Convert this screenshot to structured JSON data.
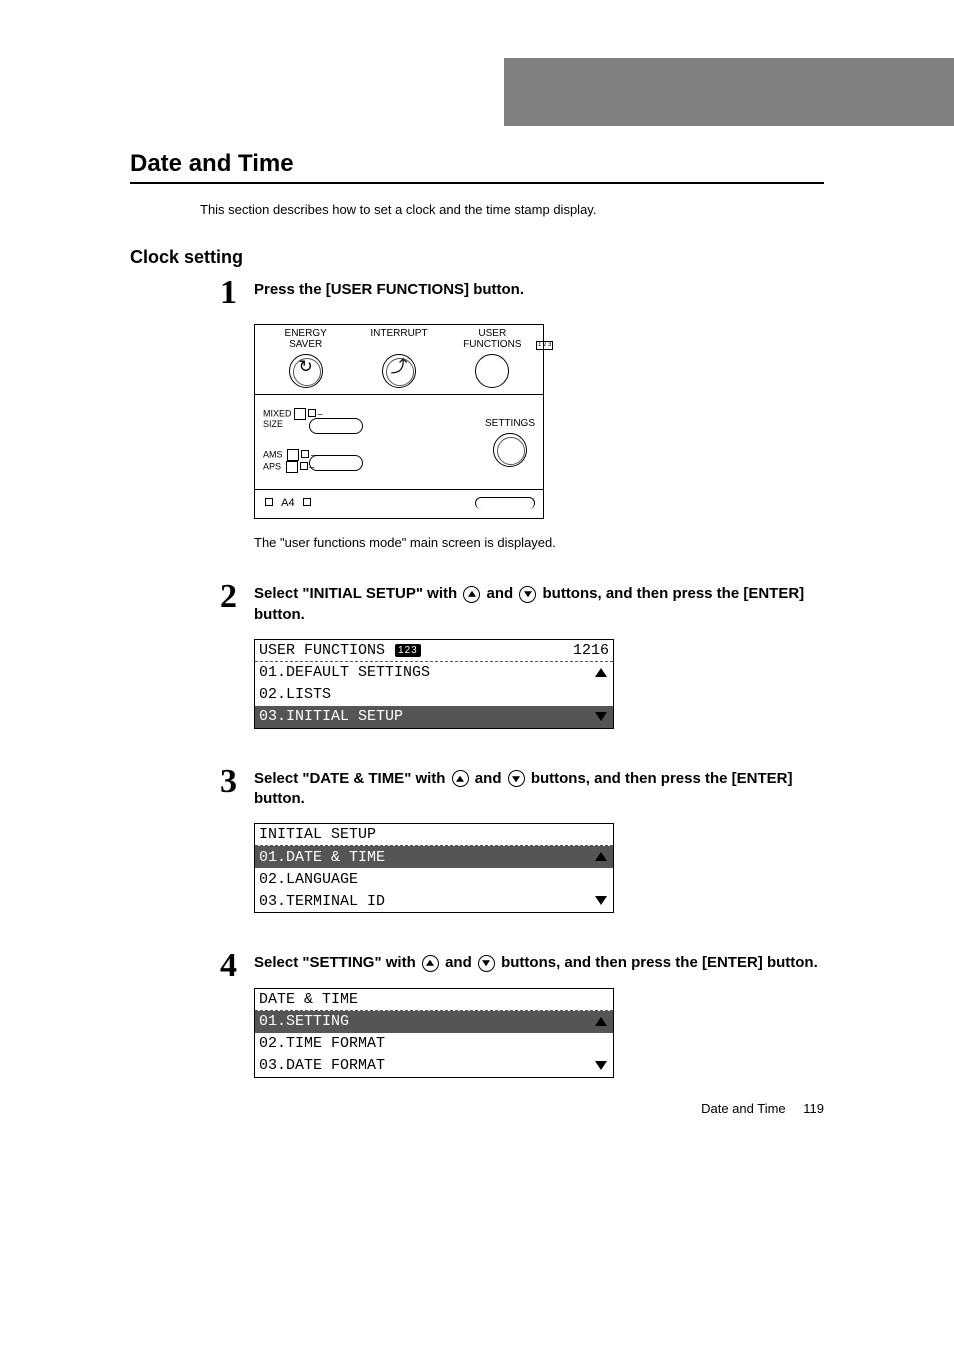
{
  "sectionTitle": "Date and Time",
  "intro": "This section describes how to set a clock and the time stamp display.",
  "subsection": "Clock setting",
  "steps": {
    "s1": {
      "num": "1",
      "title": "Press the [USER FUNCTIONS] button.",
      "note": "The \"user functions mode\" main screen is displayed."
    },
    "s2": {
      "num": "2",
      "title_a": "Select \"INITIAL SETUP\" with ",
      "title_b": " and ",
      "title_c": " buttons, and then press the [ENTER] button."
    },
    "s3": {
      "num": "3",
      "title_a": "Select \"DATE & TIME\" with ",
      "title_b": " and ",
      "title_c": " buttons, and then press the [ENTER] button."
    },
    "s4": {
      "num": "4",
      "title_a": "Select \"SETTING\" with ",
      "title_b": " and ",
      "title_c": " buttons, and then press the [ENTER] button."
    }
  },
  "panel": {
    "btn1a": "ENERGY",
    "btn1b": "SAVER",
    "btn2": "INTERRUPT",
    "btn3a": "USER",
    "btn3b": "FUNCTIONS",
    "label_mixed_a": "MIXED",
    "label_mixed_b": "SIZE",
    "label_ams": "AMS",
    "label_aps": "APS",
    "label_settings": "SETTINGS",
    "label_a4": "A4",
    "badge": "1 2 3"
  },
  "lcd1": {
    "header_left": "USER FUNCTIONS",
    "header_badge": "123",
    "header_right": "1216",
    "r1": "01.DEFAULT SETTINGS",
    "r2": "02.LISTS",
    "r3": "03.INITIAL SETUP"
  },
  "lcd2": {
    "header": "INITIAL SETUP",
    "r1": "01.DATE & TIME",
    "r2": "02.LANGUAGE",
    "r3": "03.TERMINAL ID"
  },
  "lcd3": {
    "header": "DATE & TIME",
    "r1": "01.SETTING",
    "r2": "02.TIME FORMAT",
    "r3": "03.DATE FORMAT"
  },
  "footer": {
    "label": "Date and Time",
    "page": "119"
  }
}
